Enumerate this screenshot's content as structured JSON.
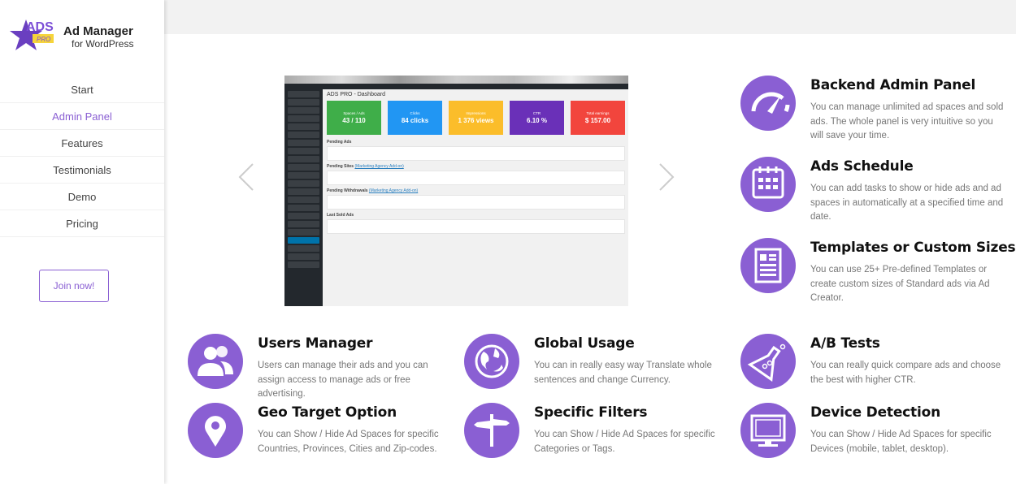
{
  "brand": {
    "logo_text": "ADS PRO",
    "title": "Ad Manager",
    "subtitle": "for WordPress"
  },
  "nav": {
    "items": [
      {
        "label": "Start"
      },
      {
        "label": "Admin Panel",
        "active": true
      },
      {
        "label": "Features"
      },
      {
        "label": "Testimonials"
      },
      {
        "label": "Demo"
      },
      {
        "label": "Pricing"
      }
    ],
    "cta": "Join now!"
  },
  "colors": {
    "accent": "#8a5fd3"
  },
  "carousel": {
    "prev_icon": "chevron-left-icon",
    "next_icon": "chevron-right-icon",
    "dashboard": {
      "title": "ADS PRO - Dashboard",
      "cards": [
        {
          "label": "Spaces / Ads",
          "value": "43 / 110",
          "color": "#3fae49"
        },
        {
          "label": "Clicks",
          "value": "84 clicks",
          "color": "#2196f3"
        },
        {
          "label": "Impressions",
          "value": "1 376 views",
          "color": "#fbbd2a"
        },
        {
          "label": "CTR",
          "value": "6.10 %",
          "color": "#6a30b8"
        },
        {
          "label": "Total earnings",
          "value": "$ 157.00",
          "color": "#f2453d"
        }
      ],
      "sections": [
        {
          "title": "Pending Ads",
          "link": ""
        },
        {
          "title": "Pending Sites",
          "link": "(Marketing Agency Add-on)"
        },
        {
          "title": "Pending Withdrawals",
          "link": "(Marketing Agency Add-on)"
        },
        {
          "title": "Last Sold Ads",
          "link": ""
        }
      ]
    }
  },
  "features": [
    {
      "icon": "speedometer-icon",
      "title": "Backend Admin Panel",
      "text": "You can manage unlimited ad spaces and sold ads. The whole panel is very intuitive so you will save your time."
    },
    {
      "icon": "calendar-icon",
      "title": "Ads Schedule",
      "text": "You can add tasks to show or hide ads and ad spaces in automatically at a specified time and date."
    },
    {
      "icon": "template-icon",
      "title": "Templates or Custom Sizes",
      "text": "You can use 25+ Pre-defined Templates or create custom sizes of Standard ads via Ad Creator."
    },
    {
      "icon": "users-icon",
      "title": "Users Manager",
      "text": "Users can manage their ads and you can assign access to manage ads or free advertising."
    },
    {
      "icon": "globe-icon",
      "title": "Global Usage",
      "text": "You can in really easy way Translate whole sentences and change Currency."
    },
    {
      "icon": "flask-icon",
      "title": "A/B Tests",
      "text": "You can really quick compare ads and choose the best with higher CTR."
    },
    {
      "icon": "map-pin-icon",
      "title": "Geo Target Option",
      "text": "You can Show / Hide Ad Spaces for specific Countries, Provinces, Cities and Zip-codes."
    },
    {
      "icon": "signpost-icon",
      "title": "Specific Filters",
      "text": "You can Show / Hide Ad Spaces for specific Categories or Tags."
    },
    {
      "icon": "monitor-icon",
      "title": "Device Detection",
      "text": "You can Show / Hide Ad Spaces for specific Devices (mobile, tablet, desktop)."
    }
  ]
}
